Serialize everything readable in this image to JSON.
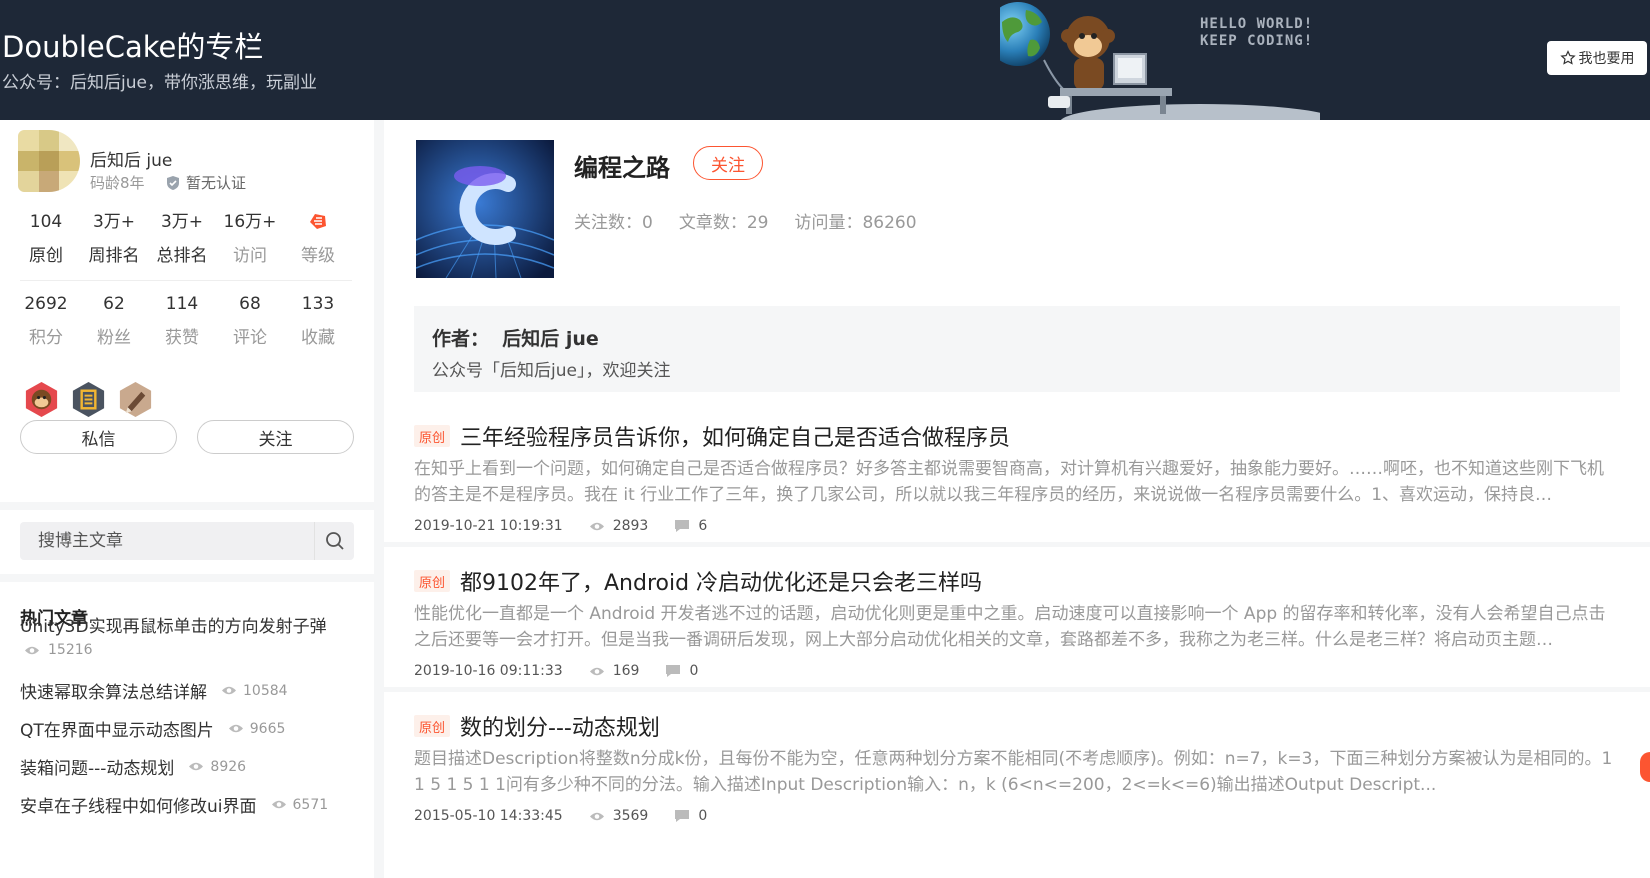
{
  "header": {
    "title": "DoubleCake的专栏",
    "subtitle": "公众号：后知后jue，带你涨思维，玩副业",
    "banner_text": [
      "HELLO WORLD!",
      "KEEP CODING!"
    ],
    "use_button": "我也要用",
    "background": "#1e2837"
  },
  "profile": {
    "username": "后知后 jue",
    "code_age": "码龄8年",
    "certification": "暂无认证",
    "stats_row1": [
      {
        "value": "104",
        "label": "原创"
      },
      {
        "value": "3万+",
        "label": "周排名"
      },
      {
        "value": "3万+",
        "label": "总排名"
      },
      {
        "value": "16万+",
        "label": "访问"
      },
      {
        "label": "等级",
        "icon": "level-icon"
      }
    ],
    "stats_row2": [
      {
        "value": "2692",
        "label": "积分"
      },
      {
        "value": "62",
        "label": "粉丝"
      },
      {
        "value": "114",
        "label": "获赞"
      },
      {
        "value": "68",
        "label": "评论"
      },
      {
        "value": "133",
        "label": "收藏"
      }
    ],
    "badges": [
      "monkey-badge-icon",
      "persistence-badge-icon",
      "pencil-badge-icon"
    ],
    "message_button": "私信",
    "follow_button": "关注"
  },
  "search": {
    "placeholder": "搜博主文章"
  },
  "hot_articles": {
    "title": "热门文章",
    "items": [
      {
        "title": "Unity3D实现再鼠标单击的方向发射子弹",
        "views": "15216"
      },
      {
        "title": "快速幂取余算法总结详解",
        "views": "10584"
      },
      {
        "title": "QT在界面中显示动态图片",
        "views": "9665"
      },
      {
        "title": "装箱问题---动态规划",
        "views": "8926"
      },
      {
        "title": "安卓在子线程中如何修改ui界面",
        "views": "6571"
      }
    ]
  },
  "column": {
    "name": "编程之路",
    "follow_label": "关注",
    "followers": "关注数：0",
    "articles": "文章数：29",
    "visits": "访问量：86260",
    "author_label": "作者：",
    "author_name": "后知后 jue",
    "author_desc": "公众号「后知后jue」，欢迎关注"
  },
  "articles": [
    {
      "tag": "原创",
      "title": "三年经验程序员告诉你，如何确定自己是否适合做程序员",
      "excerpt": "在知乎上看到一个问题，如何确定自己是否适合做程序员？好多答主都说需要智商高，对计算机有兴趣爱好，抽象能力要好。……啊呸，也不知道这些刚下飞机的答主是不是程序员。我在 it 行业工作了三年，换了几家公司，所以就以我三年程序员的经历，来说说做一名程序员需要什么。1、喜欢运动，保持良…",
      "date": "2019-10-21 10:19:31",
      "views": "2893",
      "comments": "6"
    },
    {
      "tag": "原创",
      "title": "都9102年了，Android 冷启动优化还是只会老三样吗",
      "excerpt": "性能优化一直都是一个 Android 开发者逃不过的话题，启动优化则更是重中之重。启动速度可以直接影响一个 App 的留存率和转化率，没有人会希望自己点击之后还要等一会才打开。但是当我一番调研后发现，网上大部分启动优化相关的文章，套路都差不多，我称之为老三样。什么是老三样？将启动页主题…",
      "date": "2019-10-16 09:11:33",
      "views": "169",
      "comments": "0"
    },
    {
      "tag": "原创",
      "title": "数的划分---动态规划",
      "excerpt": "题目描述Description将整数n分成k份，且每份不能为空，任意两种划分方案不能相同(不考虑顺序)。例如：n=7，k=3，下面三种划分方案被认为是相同的。1 1 5 1 5 1 1问有多少种不同的分法。输入描述Input Description输入：n，k (6<n<=200，2<=k<=6)输出描述Output Descript...",
      "date": "2015-05-10 14:33:45",
      "views": "3569",
      "comments": "0"
    }
  ],
  "colors": {
    "accent": "#fc5531",
    "page_bg": "#f5f6f7"
  }
}
